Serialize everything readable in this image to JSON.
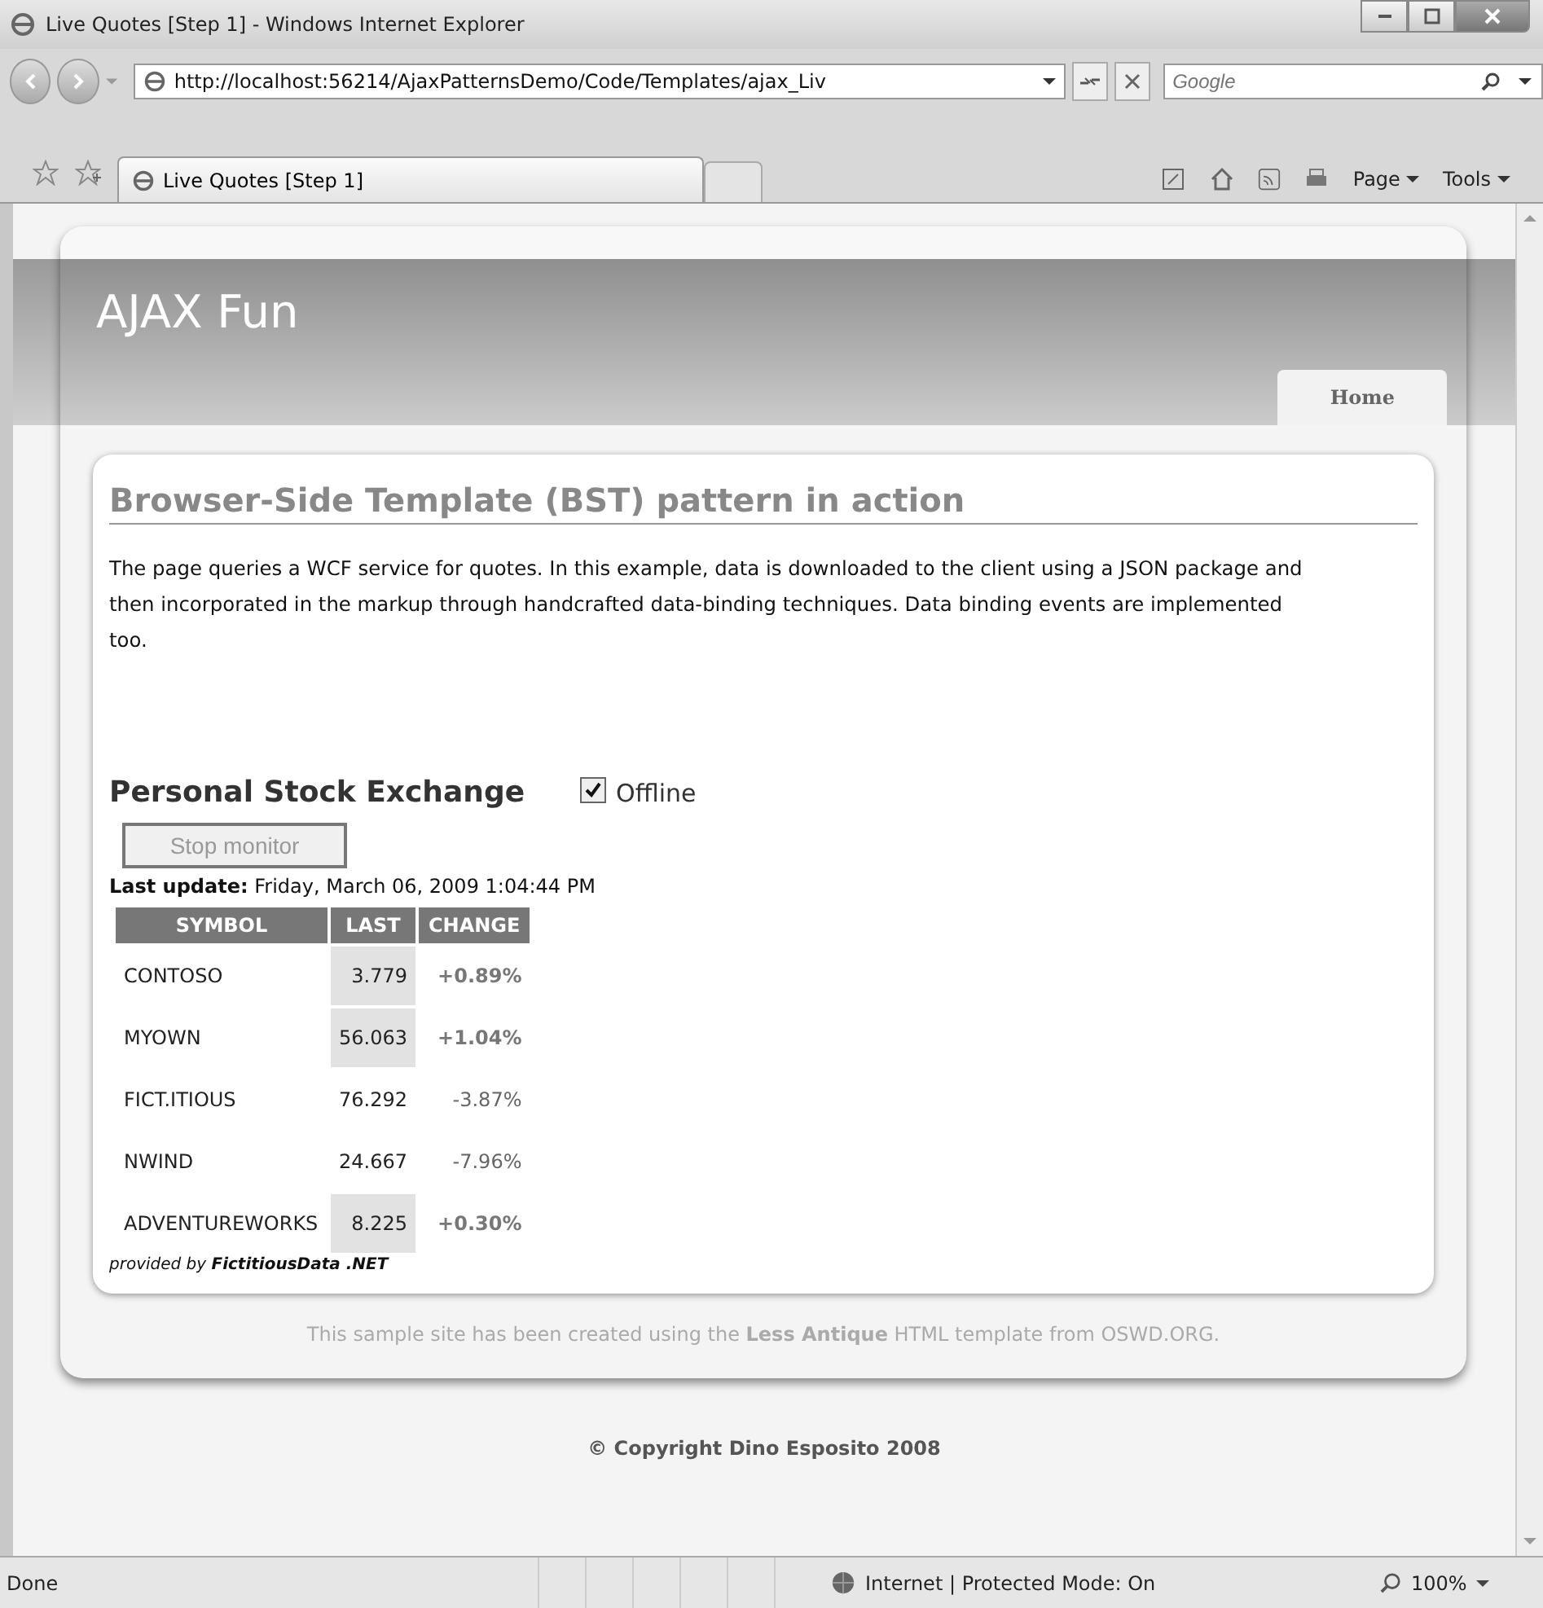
{
  "window": {
    "title": "Live Quotes [Step 1] - Windows Internet Explorer"
  },
  "address_bar": {
    "url": "http://localhost:56214/AjaxPatternsDemo/Code/Templates/ajax_Liv"
  },
  "search": {
    "placeholder": "Google"
  },
  "browser_tab": {
    "label": "Live Quotes [Step 1]"
  },
  "command_bar": [
    "Page",
    "Tools"
  ],
  "site": {
    "title": "AJAX Fun",
    "nav_tabs": [
      {
        "label": "Home",
        "selected": true
      }
    ]
  },
  "content": {
    "heading": "Browser-Side Template (BST) pattern in action",
    "paragraph": "The page queries a WCF service for quotes. In this example, data is downloaded to the client using a JSON package and then incorporated in the markup through handcrafted data-binding techniques. Data binding events are implemented too.",
    "section_title": "Personal Stock Exchange",
    "offline": {
      "label": "Offline",
      "checked": true
    },
    "button": {
      "label": "Stop monitor",
      "disabled": true
    },
    "last_update": {
      "label": "Last update:",
      "value": "Friday, March 06, 2009 1:04:44 PM"
    },
    "table": {
      "columns": [
        "SYMBOL",
        "LAST",
        "CHANGE"
      ],
      "rows": [
        {
          "symbol": "CONTOSO",
          "last": "3.779",
          "change": "+0.89%",
          "highlighted": true,
          "kind": "up"
        },
        {
          "symbol": "MYOWN",
          "last": "56.063",
          "change": "+1.04%",
          "highlighted": true,
          "kind": "up"
        },
        {
          "symbol": "FICT.ITIOUS",
          "last": "76.292",
          "change": "-3.87%",
          "highlighted": false,
          "kind": "down"
        },
        {
          "symbol": "NWIND",
          "last": "24.667",
          "change": "-7.96%",
          "highlighted": false,
          "kind": "down"
        },
        {
          "symbol": "ADVENTUREWORKS",
          "last": "8.225",
          "change": "+0.30%",
          "highlighted": true,
          "kind": "up"
        }
      ]
    },
    "provided_by": "provided by **FictitiousData .NET**"
  },
  "credit": "This sample site has been created using the **Less Antique** HTML template from OSWD.ORG.",
  "copyright": "© Copyright Dino Esposito 2008",
  "status_bar": {
    "status": "Done",
    "zone": "Internet | Protected Mode: On",
    "zoom": "100%"
  }
}
